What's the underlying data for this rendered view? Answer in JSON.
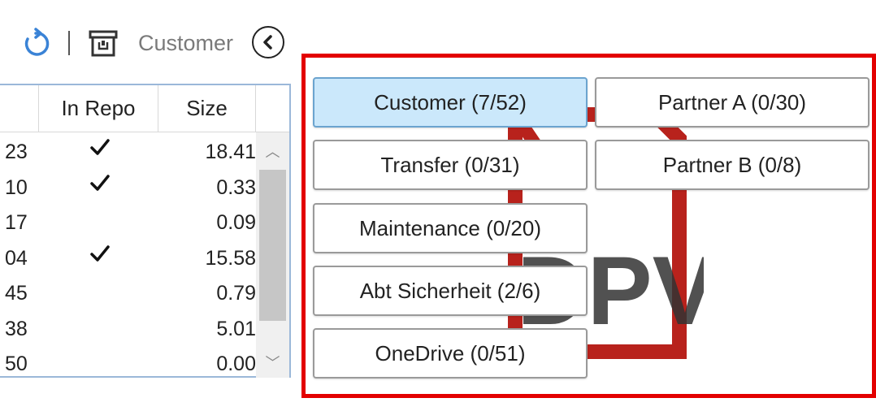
{
  "toolbar": {
    "refresh_icon": "refresh-icon",
    "archive_icon": "archive-icon",
    "breadcrumb": "Customer",
    "back_icon": "chevron-left-icon"
  },
  "table": {
    "columns": [
      "",
      "In Repo",
      "Size"
    ],
    "rows": [
      {
        "id": "23",
        "in_repo": true,
        "size": "18.41"
      },
      {
        "id": "10",
        "in_repo": true,
        "size": "0.33"
      },
      {
        "id": "17",
        "in_repo": false,
        "size": "0.09"
      },
      {
        "id": "04",
        "in_repo": true,
        "size": "15.58"
      },
      {
        "id": "45",
        "in_repo": false,
        "size": "0.79"
      },
      {
        "id": "38",
        "in_repo": false,
        "size": "5.01"
      },
      {
        "id": "50",
        "in_repo": false,
        "size": "0.00"
      }
    ],
    "check_glyph": "✓"
  },
  "panel": {
    "logo_text": "DPV",
    "accent_color": "#e30000",
    "buttons": [
      {
        "label": "Customer (7/52)",
        "active": true
      },
      {
        "label": "Partner A (0/30)",
        "active": false
      },
      {
        "label": "Transfer (0/31)",
        "active": false
      },
      {
        "label": "Partner B (0/8)",
        "active": false
      },
      {
        "label": "Maintenance (0/20)",
        "active": false
      },
      {
        "label": "Abt Sicherheit (2/6)",
        "active": false
      },
      {
        "label": "OneDrive (0/51)",
        "active": false
      }
    ]
  }
}
